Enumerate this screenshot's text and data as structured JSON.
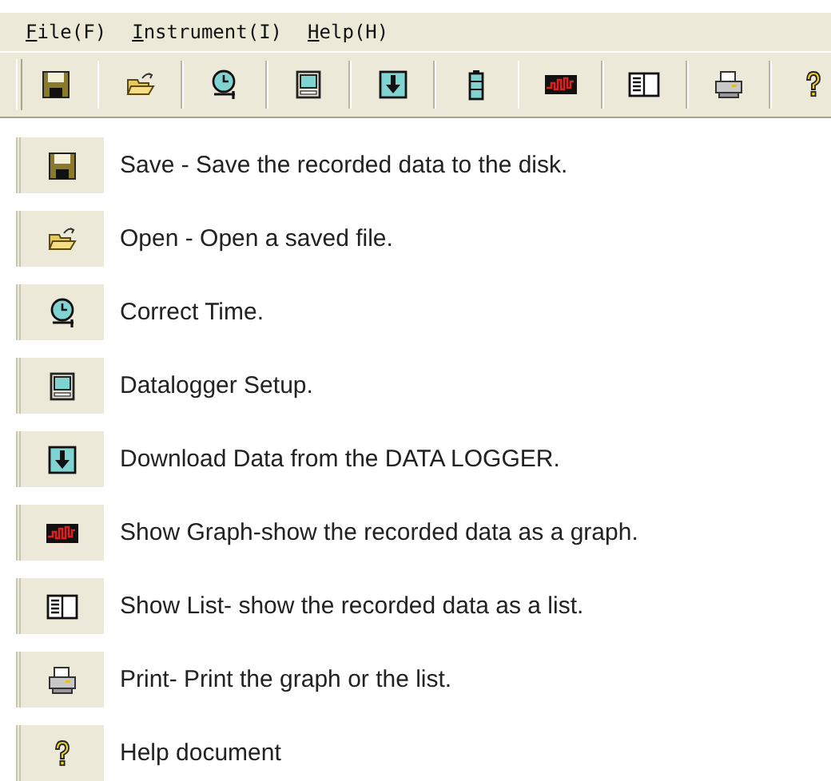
{
  "menu": [
    {
      "label": "File(F)"
    },
    {
      "label": "Instrument(I)"
    },
    {
      "label": "Help(H)"
    }
  ],
  "toolbar": [
    {
      "kind": "save"
    },
    {
      "kind": "open"
    },
    {
      "kind": "clock"
    },
    {
      "kind": "setup"
    },
    {
      "kind": "download"
    },
    {
      "kind": "battery"
    },
    {
      "kind": "graph"
    },
    {
      "kind": "list"
    },
    {
      "kind": "print"
    },
    {
      "kind": "help"
    }
  ],
  "legend": [
    {
      "kind": "save",
      "text": "Save - Save the recorded data to the disk."
    },
    {
      "kind": "open",
      "text": "Open - Open a saved file."
    },
    {
      "kind": "clock",
      "text": "Correct Time."
    },
    {
      "kind": "setup",
      "text": "Datalogger Setup."
    },
    {
      "kind": "download",
      "text": "Download Data from the DATA LOGGER."
    },
    {
      "kind": "graph",
      "text": "Show Graph-show the recorded data as a graph."
    },
    {
      "kind": "list",
      "text": "Show List- show the recorded data as a list."
    },
    {
      "kind": "print",
      "text": "Print- Print the graph or the list."
    },
    {
      "kind": "help",
      "text": "Help document"
    }
  ]
}
